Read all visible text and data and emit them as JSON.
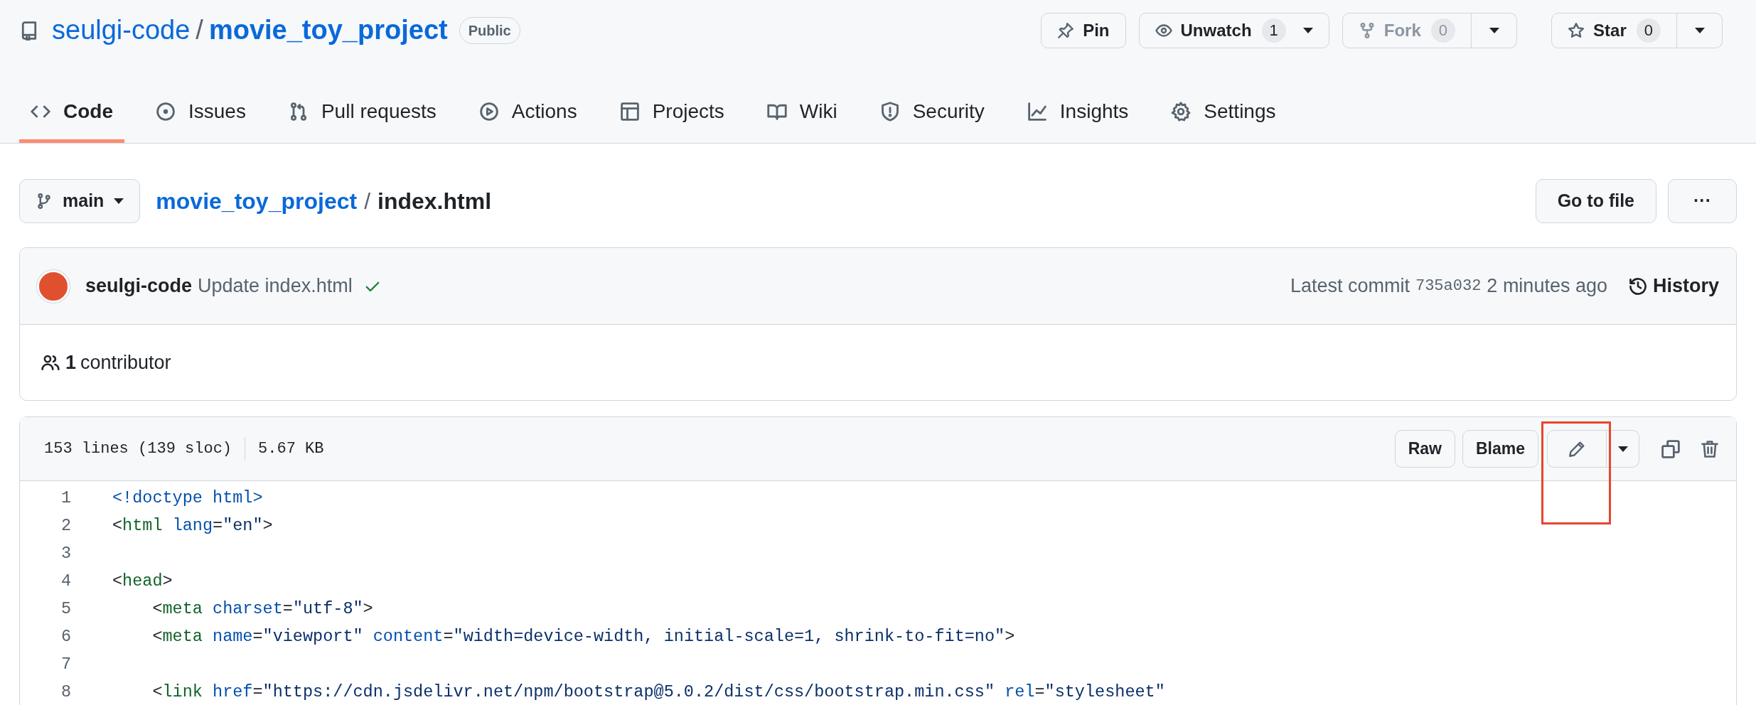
{
  "repo": {
    "owner": "seulgi-code",
    "separator": "/",
    "name": "movie_toy_project",
    "visibility": "Public"
  },
  "repo_actions": [
    {
      "kind": "pin",
      "label": "Pin"
    },
    {
      "kind": "watch",
      "label": "Unwatch",
      "count": "1",
      "disabled": false
    },
    {
      "kind": "fork",
      "label": "Fork",
      "count": "0",
      "disabled": true
    },
    {
      "kind": "star",
      "label": "Star",
      "count": "0",
      "disabled": false
    }
  ],
  "tabs": [
    {
      "label": "Code",
      "selected": true
    },
    {
      "label": "Issues",
      "selected": false
    },
    {
      "label": "Pull requests",
      "selected": false
    },
    {
      "label": "Actions",
      "selected": false
    },
    {
      "label": "Projects",
      "selected": false
    },
    {
      "label": "Wiki",
      "selected": false
    },
    {
      "label": "Security",
      "selected": false
    },
    {
      "label": "Insights",
      "selected": false
    },
    {
      "label": "Settings",
      "selected": false
    }
  ],
  "branch": "main",
  "breadcrumb": {
    "repo": "movie_toy_project",
    "separator": "/",
    "file": "index.html"
  },
  "file_actions": {
    "go_to_file": "Go to file",
    "more": "···"
  },
  "commit": {
    "author": "seulgi-code",
    "message": "Update index.html",
    "checks_passed": true,
    "prefix": "Latest commit",
    "sha": "735a032",
    "time": "2 minutes ago",
    "history": "History"
  },
  "contributors": {
    "count": "1",
    "label": "contributor"
  },
  "file": {
    "lines": "153 lines (139 sloc)",
    "size": "5.67 KB",
    "raw": "Raw",
    "blame": "Blame",
    "edit_annotated": true,
    "code": [
      {
        "number": "1",
        "tokens": [
          {
            "kind": "keyword",
            "text": "<!doctype html>"
          }
        ]
      },
      {
        "number": "2",
        "tokens": [
          {
            "kind": "punct",
            "text": "<"
          },
          {
            "kind": "tag",
            "text": "html"
          },
          {
            "kind": "attr",
            "text": " lang"
          },
          {
            "kind": "punct",
            "text": "="
          },
          {
            "kind": "string",
            "text": "\"en\""
          },
          {
            "kind": "punct",
            "text": ">"
          }
        ]
      },
      {
        "number": "3"
      },
      {
        "number": "4",
        "tokens": [
          {
            "kind": "punct",
            "text": "<"
          },
          {
            "kind": "tag",
            "text": "head"
          },
          {
            "kind": "punct",
            "text": ">"
          }
        ]
      },
      {
        "number": "5",
        "tokens": [
          {
            "kind": "punct",
            "text": "    <"
          },
          {
            "kind": "tag",
            "text": "meta"
          },
          {
            "kind": "attr",
            "text": " charset"
          },
          {
            "kind": "punct",
            "text": "="
          },
          {
            "kind": "string",
            "text": "\"utf-8\""
          },
          {
            "kind": "punct",
            "text": ">"
          }
        ]
      },
      {
        "number": "6",
        "tokens": [
          {
            "kind": "punct",
            "text": "    <"
          },
          {
            "kind": "tag",
            "text": "meta"
          },
          {
            "kind": "attr",
            "text": " name"
          },
          {
            "kind": "punct",
            "text": "="
          },
          {
            "kind": "string",
            "text": "\"viewport\""
          },
          {
            "kind": "attr",
            "text": " content"
          },
          {
            "kind": "punct",
            "text": "="
          },
          {
            "kind": "string",
            "text": "\"width=device-width, initial-scale=1, shrink-to-fit=no\""
          },
          {
            "kind": "punct",
            "text": ">"
          }
        ]
      },
      {
        "number": "7"
      },
      {
        "number": "8",
        "tokens": [
          {
            "kind": "punct",
            "text": "    <"
          },
          {
            "kind": "tag",
            "text": "link"
          },
          {
            "kind": "attr",
            "text": " href"
          },
          {
            "kind": "punct",
            "text": "="
          },
          {
            "kind": "string",
            "text": "\"https://cdn.jsdelivr.net/npm/bootstrap@5.0.2/dist/css/bootstrap.min.css\""
          },
          {
            "kind": "attr",
            "text": " rel"
          },
          {
            "kind": "punct",
            "text": "="
          },
          {
            "kind": "string",
            "text": "\"stylesheet\""
          }
        ]
      }
    ]
  }
}
